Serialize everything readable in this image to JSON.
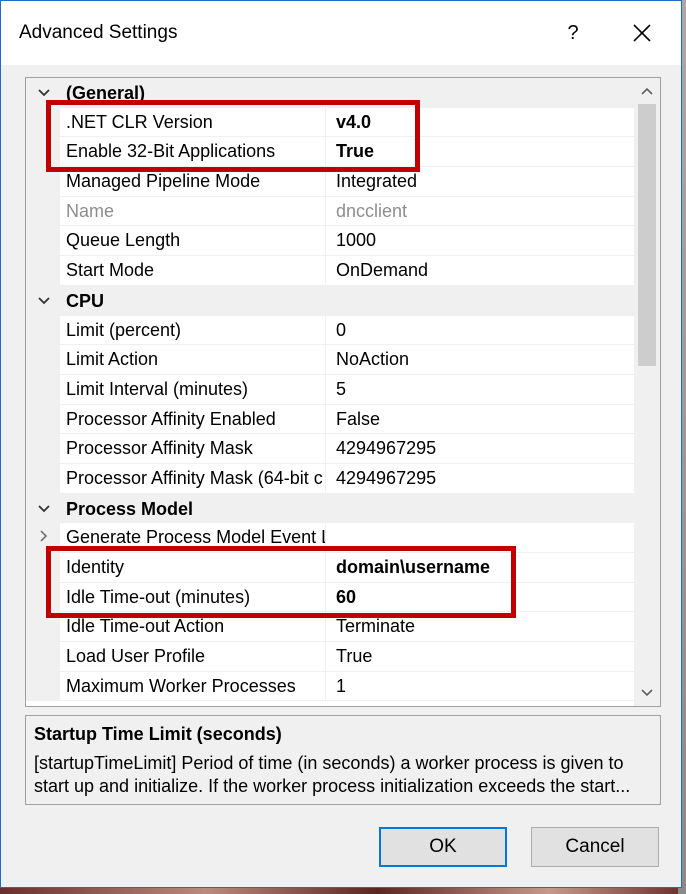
{
  "window": {
    "title": "Advanced Settings",
    "help_label": "?",
    "close_icon": "close-icon"
  },
  "grid": {
    "categories": [
      {
        "label": "(General)",
        "expanded": true,
        "items": [
          {
            "name": ".NET CLR Version",
            "value": "v4.0",
            "bold": true,
            "disabled": false
          },
          {
            "name": "Enable 32-Bit Applications",
            "value": "True",
            "bold": true,
            "disabled": false
          },
          {
            "name": "Managed Pipeline Mode",
            "value": "Integrated",
            "bold": false,
            "disabled": false
          },
          {
            "name": "Name",
            "value": "dncclient",
            "bold": false,
            "disabled": true
          },
          {
            "name": "Queue Length",
            "value": "1000",
            "bold": false,
            "disabled": false
          },
          {
            "name": "Start Mode",
            "value": "OnDemand",
            "bold": false,
            "disabled": false
          }
        ]
      },
      {
        "label": "CPU",
        "expanded": true,
        "items": [
          {
            "name": "Limit (percent)",
            "value": "0",
            "bold": false,
            "disabled": false
          },
          {
            "name": "Limit Action",
            "value": "NoAction",
            "bold": false,
            "disabled": false
          },
          {
            "name": "Limit Interval (minutes)",
            "value": "5",
            "bold": false,
            "disabled": false
          },
          {
            "name": "Processor Affinity Enabled",
            "value": "False",
            "bold": false,
            "disabled": false
          },
          {
            "name": "Processor Affinity Mask",
            "value": "4294967295",
            "bold": false,
            "disabled": false
          },
          {
            "name": "Processor Affinity Mask (64-bit c",
            "value": "4294967295",
            "bold": false,
            "disabled": false
          }
        ]
      },
      {
        "label": "Process Model",
        "expanded": true,
        "items": [
          {
            "name": "Generate Process Model Event L",
            "value": "",
            "bold": false,
            "disabled": false,
            "collapsible": true
          },
          {
            "name": "Identity",
            "value": "domain\\username",
            "bold": true,
            "disabled": false
          },
          {
            "name": "Idle Time-out (minutes)",
            "value": "60",
            "bold": true,
            "disabled": false
          },
          {
            "name": "Idle Time-out Action",
            "value": "Terminate",
            "bold": false,
            "disabled": false
          },
          {
            "name": "Load User Profile",
            "value": "True",
            "bold": false,
            "disabled": false
          },
          {
            "name": "Maximum Worker Processes",
            "value": "1",
            "bold": false,
            "disabled": false
          }
        ]
      }
    ]
  },
  "description": {
    "title": "Startup Time Limit (seconds)",
    "text": "[startupTimeLimit] Period of time (in seconds) a worker process is given to start up and initialize. If the worker process initialization exceeds the start..."
  },
  "buttons": {
    "ok": "OK",
    "cancel": "Cancel"
  },
  "colors": {
    "highlight": "#c00000",
    "accent": "#0078d7"
  }
}
